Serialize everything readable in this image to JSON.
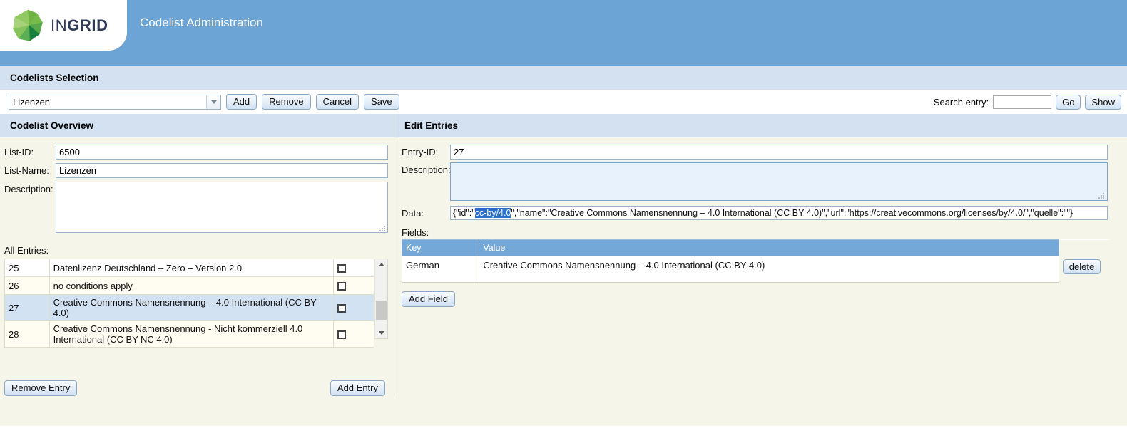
{
  "header": {
    "logo_text_light": "IN",
    "logo_text_bold": "GRID",
    "logo_icon": "ingrid-polygon-logo",
    "title": "Codelist Administration",
    "brand_color": "#6ba4d5",
    "logo_green": "#79bf54"
  },
  "codelists_selection": {
    "band_title": "Codelists Selection",
    "selected_codelist": "Lizenzen",
    "dropdown_icon": "chevron-down-icon",
    "buttons": {
      "add": "Add",
      "remove": "Remove",
      "cancel": "Cancel",
      "save": "Save"
    },
    "search": {
      "label": "Search entry:",
      "value": "",
      "placeholder": "",
      "go": "Go",
      "show": "Show"
    }
  },
  "codelist_overview": {
    "band_title": "Codelist Overview",
    "fields": {
      "list_id_label": "List-ID:",
      "list_id_value": "6500",
      "list_name_label": "List-Name:",
      "list_name_value": "Lizenzen",
      "description_label": "Description:",
      "description_value": "",
      "description_placeholder": ""
    },
    "all_entries_label": "All Entries:",
    "entries": [
      {
        "id": "25",
        "name": "Datenlizenz Deutschland – Zero – Version 2.0",
        "checked": false,
        "selected": false,
        "row_style": "white"
      },
      {
        "id": "26",
        "name": "no conditions apply",
        "checked": false,
        "selected": false,
        "row_style": "alt"
      },
      {
        "id": "27",
        "name": "Creative Commons Namensnennung – 4.0 International (CC BY 4.0)",
        "checked": false,
        "selected": true,
        "row_style": "sel"
      },
      {
        "id": "28",
        "name": "Creative Commons Namensnennung - Nicht kommerziell 4.0 International (CC BY-NC 4.0)",
        "checked": false,
        "selected": false,
        "row_style": "alt"
      }
    ],
    "scrollbar": {
      "up_icon": "chevron-up-icon",
      "down_icon": "chevron-down-icon"
    },
    "buttons": {
      "remove_entry": "Remove Entry",
      "add_entry": "Add Entry"
    }
  },
  "edit_entries": {
    "band_title": "Edit Entries",
    "entry_id_label": "Entry-ID:",
    "entry_id_value": "27",
    "description_label": "Description:",
    "description_value": "",
    "data_label": "Data:",
    "data_value_prefix": "{\"id\":\"",
    "data_value_selected": "cc-by/4.0",
    "data_value_suffix": "\",\"name\":\"Creative Commons Namensnennung – 4.0 International (CC BY 4.0)\",\"url\":\"https://creativecommons.org/licenses/by/4.0/\",\"quelle\":\"\"}",
    "fields_label": "Fields:",
    "fields_columns": [
      "Key",
      "Value",
      ""
    ],
    "fields_rows": [
      {
        "key": "German",
        "value": "Creative Commons Namensnennung – 4.0 International (CC BY 4.0)",
        "delete_label": "delete"
      }
    ],
    "add_field_label": "Add Field"
  },
  "colors": {
    "band_bg": "#d3e1f0",
    "content_bg": "#f5f6e9",
    "table_header_bg": "#74a8d8",
    "row_selected_bg": "#d3e2f2",
    "focus_field_bg": "#e8f2fc",
    "text_selection_bg": "#2a6fc9"
  }
}
